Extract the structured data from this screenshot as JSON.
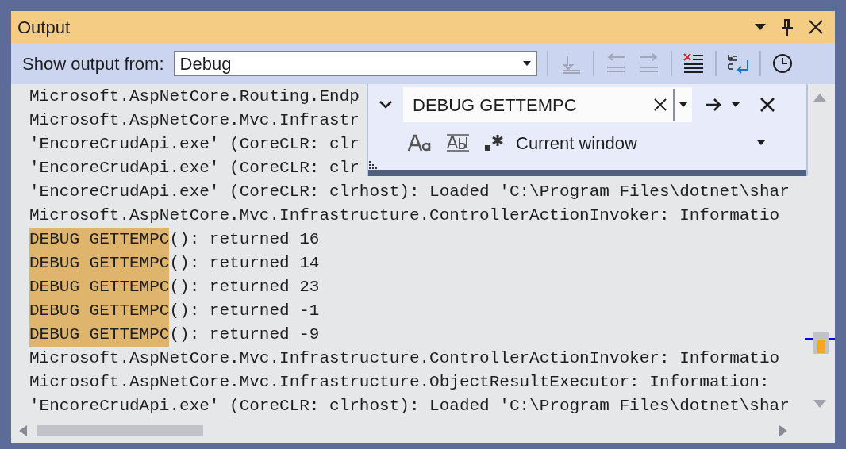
{
  "window": {
    "title": "Output"
  },
  "toolbar": {
    "label": "Show output from:",
    "source": {
      "value": "Debug"
    },
    "buttons": [
      {
        "kind": "goto",
        "disabled": true
      },
      {
        "kind": "prev",
        "disabled": true
      },
      {
        "kind": "next",
        "disabled": true
      },
      {
        "kind": "clear",
        "disabled": false
      },
      {
        "kind": "wrap",
        "disabled": false
      },
      {
        "kind": "clock",
        "disabled": false
      }
    ]
  },
  "find": {
    "query": "DEBUG GETTEMPC",
    "scope": "Current window"
  },
  "lines": [
    {
      "text": "Microsoft.AspNetCore.Routing.Endp"
    },
    {
      "text": "Microsoft.AspNetCore.Mvc.Infrastr"
    },
    {
      "text": "'EncoreCrudApi.exe' (CoreCLR: clr"
    },
    {
      "text": "'EncoreCrudApi.exe' (CoreCLR: clr"
    },
    {
      "text": "'EncoreCrudApi.exe' (CoreCLR: clrhost): Loaded 'C:\\Program Files\\dotnet\\shar"
    },
    {
      "text": "Microsoft.AspNetCore.Mvc.Infrastructure.ControllerActionInvoker: Informatio"
    },
    {
      "match": "DEBUG GETTEMPC",
      "text": "(): returned 16"
    },
    {
      "match": "DEBUG GETTEMPC",
      "text": "(): returned 14"
    },
    {
      "match": "DEBUG GETTEMPC",
      "text": "(): returned 23"
    },
    {
      "match": "DEBUG GETTEMPC",
      "text": "(): returned -1"
    },
    {
      "match": "DEBUG GETTEMPC",
      "text": "(): returned -9"
    },
    {
      "text": "Microsoft.AspNetCore.Mvc.Infrastructure.ControllerActionInvoker: Informatio"
    },
    {
      "text": "Microsoft.AspNetCore.Mvc.Infrastructure.ObjectResultExecutor: Information:"
    },
    {
      "text": "'EncoreCrudApi.exe' (CoreCLR: clrhost): Loaded 'C:\\Program Files\\dotnet\\shar"
    }
  ]
}
